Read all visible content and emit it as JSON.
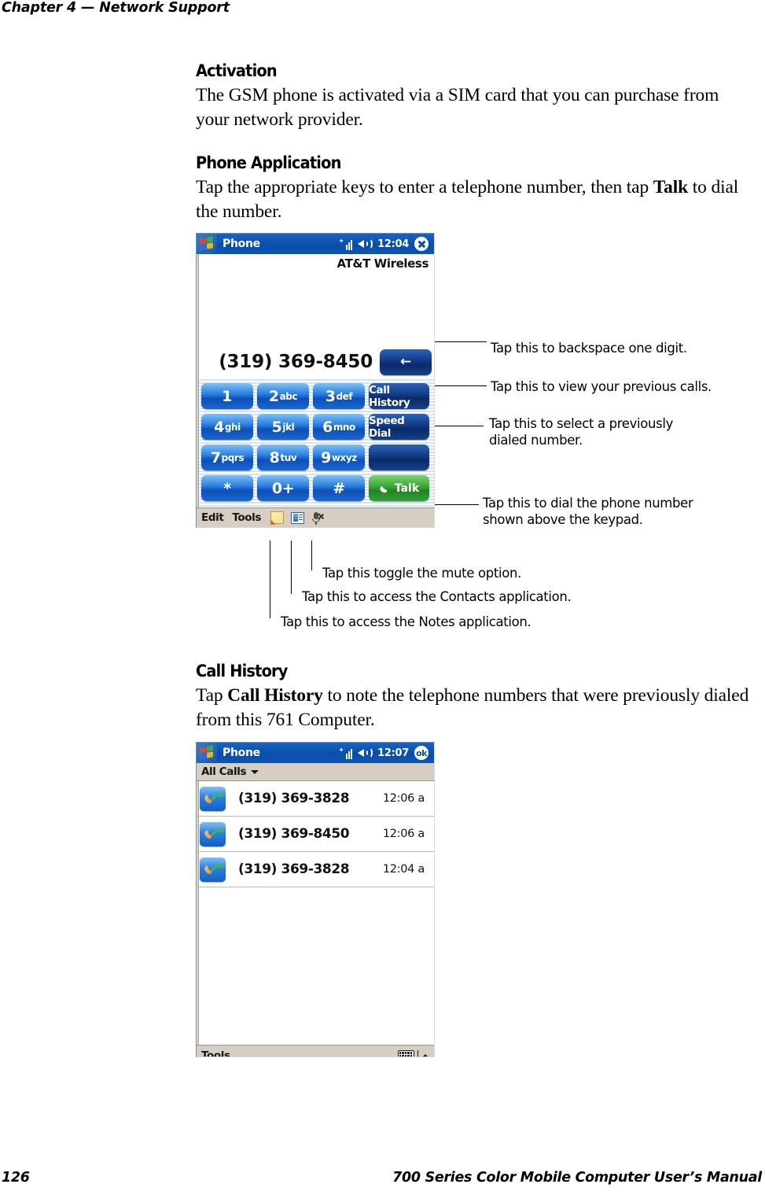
{
  "page": {
    "running_head_chapter": "Chapter 4",
    "running_head_dash": "—",
    "running_head_title": "Network Support",
    "footer_page_number": "126",
    "footer_manual_title": "700 Series Color Mobile Computer User’s Manual"
  },
  "sections": {
    "activation": {
      "heading": "Activation",
      "body": "The GSM phone is activated via a SIM card that you can purchase from your network provider."
    },
    "phone_application": {
      "heading": "Phone Application",
      "body_part1": "Tap the appropriate keys to enter a telephone number, then tap ",
      "body_emph": "Talk",
      "body_part2": " to dial the number."
    },
    "call_history": {
      "heading": "Call History",
      "body_part1": "Tap ",
      "body_emph": "Call History",
      "body_part2": " to note the telephone numbers that were previously dialed from this 761 Computer."
    }
  },
  "phone_screen": {
    "title": "Phone",
    "clock": "12:04",
    "close_button_label": "close",
    "carrier": "AT&T Wireless",
    "dialed_number": "(319) 369-8450",
    "backspace_label": "←",
    "keys": [
      {
        "digit": "1",
        "letters": ""
      },
      {
        "digit": "2",
        "letters": "abc"
      },
      {
        "digit": "3",
        "letters": "def"
      },
      {
        "digit": "4",
        "letters": "ghi"
      },
      {
        "digit": "5",
        "letters": "jkl"
      },
      {
        "digit": "6",
        "letters": "mno"
      },
      {
        "digit": "7",
        "letters": "pqrs"
      },
      {
        "digit": "8",
        "letters": "tuv"
      },
      {
        "digit": "9",
        "letters": "wxyz"
      },
      {
        "digit": "*",
        "letters": ""
      },
      {
        "digit": "0+",
        "letters": ""
      },
      {
        "digit": "#",
        "letters": ""
      }
    ],
    "function_keys": {
      "call_history": "Call History",
      "speed_dial": "Speed Dial",
      "blank": "",
      "talk": "Talk"
    },
    "command_bar": {
      "edit": "Edit",
      "tools": "Tools",
      "icon_note": "note-icon",
      "icon_contacts": "contacts-icon",
      "icon_mute": "mute-icon"
    }
  },
  "callouts": {
    "backspace": "Tap this to backspace one digit.",
    "call_history": "Tap this to view your previous calls.",
    "speed_dial": "Tap this to select a previously\ndialed number.",
    "talk": "Tap this to dial the phone number\nshown above the keypad.",
    "mute": "Tap this toggle the mute option.",
    "contacts": "Tap this to access the Contacts application.",
    "notes": "Tap this to access the Notes application."
  },
  "call_history_screen": {
    "title": "Phone",
    "clock": "12:07",
    "ok_button_label": "ok",
    "filter_label": "All Calls",
    "calls": [
      {
        "icon": "outgoing-call-icon",
        "number": "(319) 369-3828",
        "time": "12:06 a"
      },
      {
        "icon": "outgoing-call-icon",
        "number": "(319) 369-8450",
        "time": "12:06 a"
      },
      {
        "icon": "outgoing-call-icon",
        "number": "(319) 369-3828",
        "time": "12:04 a"
      }
    ],
    "command_bar": {
      "tools": "Tools",
      "icon_keyboard": "keyboard-icon",
      "icon_caret_up": "caret-up-icon"
    }
  },
  "colors": {
    "titlebar_blue": "#0a4ea8",
    "command_bar_tan": "#d6cec2",
    "talk_green": "#3da83a",
    "key_blue": "#2a7fe0",
    "function_key_navy": "#123a84"
  }
}
